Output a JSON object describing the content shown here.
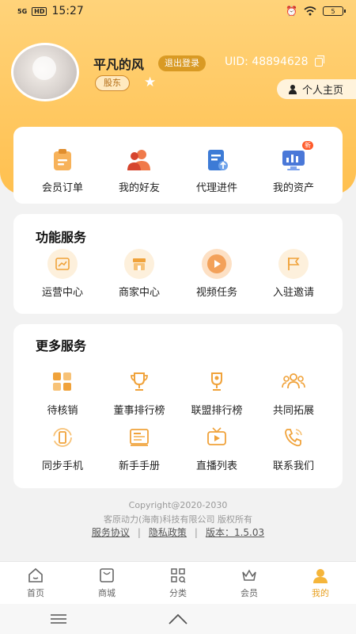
{
  "status_bar": {
    "signal": "5G",
    "hd": "HD",
    "time": "15:27",
    "battery": "5"
  },
  "profile": {
    "nickname": "平凡的风",
    "logout_label": "退出登录",
    "uid": "UID: 48894628",
    "role": "股东",
    "homepage_label": "个人主页"
  },
  "orders": {
    "items": [
      {
        "label": "会员订单",
        "icon": "order-clipboard-icon"
      },
      {
        "label": "我的好友",
        "icon": "friends-icon"
      },
      {
        "label": "代理进件",
        "icon": "upload-doc-icon"
      },
      {
        "label": "我的资产",
        "icon": "assets-monitor-icon",
        "badge": "新"
      }
    ]
  },
  "functions": {
    "title": "功能服务",
    "items": [
      {
        "label": "运营中心",
        "icon": "chart-icon"
      },
      {
        "label": "商家中心",
        "icon": "store-icon"
      },
      {
        "label": "视频任务",
        "icon": "play-icon"
      },
      {
        "label": "入驻邀请",
        "icon": "flag-icon"
      }
    ]
  },
  "more": {
    "title": "更多服务",
    "items": [
      {
        "label": "待核销",
        "icon": "grid-icon"
      },
      {
        "label": "董事排行榜",
        "icon": "trophy-icon"
      },
      {
        "label": "联盟排行榜",
        "icon": "trophy-icon"
      },
      {
        "label": "共同拓展",
        "icon": "group-icon"
      },
      {
        "label": "同步手机",
        "icon": "phone-sync-icon"
      },
      {
        "label": "新手手册",
        "icon": "manual-icon"
      },
      {
        "label": "直播列表",
        "icon": "tv-icon"
      },
      {
        "label": "联系我们",
        "icon": "phone-call-icon"
      }
    ]
  },
  "footer": {
    "copyright": "Copyright@2020-2030",
    "company": "客原动力(海南)科技有限公司 版权所有",
    "service_agreement": "服务协议",
    "privacy_policy": "隐私政策",
    "version": "版本：1.5.03"
  },
  "tabbar": {
    "items": [
      {
        "label": "首页",
        "icon": "home-icon"
      },
      {
        "label": "商城",
        "icon": "shop-bag-icon"
      },
      {
        "label": "分类",
        "icon": "category-icon"
      },
      {
        "label": "会员",
        "icon": "crown-icon"
      },
      {
        "label": "我的",
        "icon": "user-icon"
      }
    ]
  },
  "colors": {
    "accent": "#ffc04f",
    "active_tab": "#e8a020",
    "icon": "#f0a23a"
  }
}
